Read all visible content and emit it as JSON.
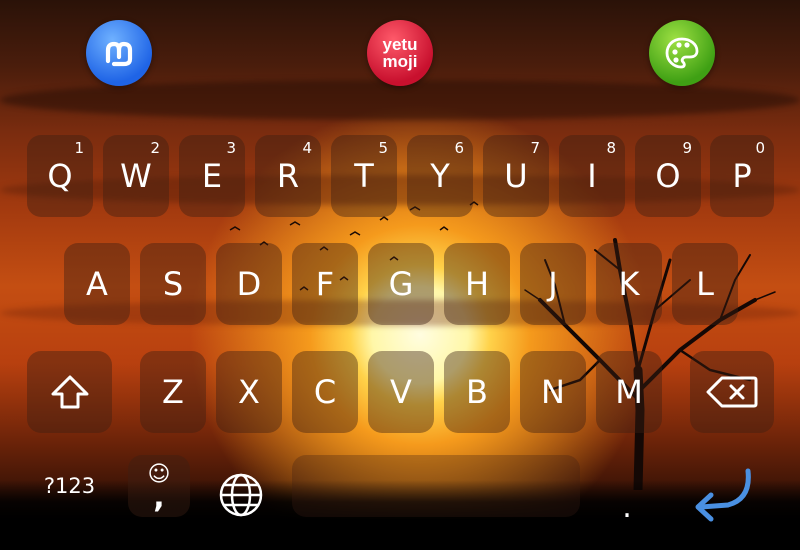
{
  "toolbar": {
    "apps": [
      {
        "name": "mastodon",
        "label": ""
      },
      {
        "name": "yetumoji",
        "line1": "yetu",
        "line2": "moji"
      },
      {
        "name": "palette",
        "label": ""
      }
    ]
  },
  "keyboard": {
    "row1": [
      {
        "label": "Q",
        "hint": "1"
      },
      {
        "label": "W",
        "hint": "2"
      },
      {
        "label": "E",
        "hint": "3"
      },
      {
        "label": "R",
        "hint": "4"
      },
      {
        "label": "T",
        "hint": "5"
      },
      {
        "label": "Y",
        "hint": "6"
      },
      {
        "label": "U",
        "hint": "7"
      },
      {
        "label": "I",
        "hint": "8"
      },
      {
        "label": "O",
        "hint": "9"
      },
      {
        "label": "P",
        "hint": "0"
      }
    ],
    "row2": [
      "A",
      "S",
      "D",
      "F",
      "G",
      "H",
      "J",
      "K",
      "L"
    ],
    "row3": [
      "Z",
      "X",
      "C",
      "V",
      "B",
      "N",
      "M"
    ],
    "row4": {
      "symbols_label": "?123",
      "comma_label": ",",
      "emoji_glyph": "☺",
      "period_label": "."
    }
  },
  "colors": {
    "key_background": "#3c1e14",
    "enter_arrow": "#4a90e2",
    "text": "#ffffff"
  }
}
